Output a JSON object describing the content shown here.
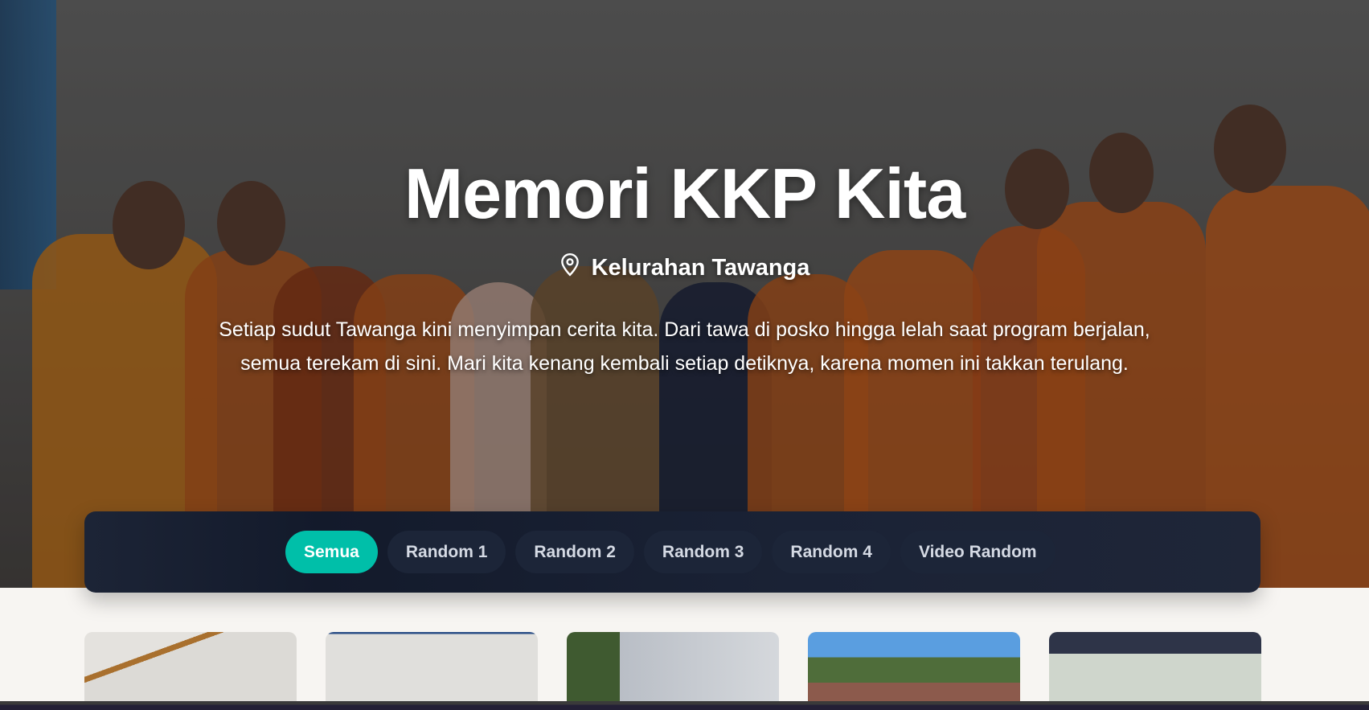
{
  "hero": {
    "title": "Memori KKP Kita",
    "location": "Kelurahan Tawanga",
    "location_icon": "map-pin-icon",
    "description": "Setiap sudut Tawanga kini menyimpan cerita kita. Dari tawa di posko hingga lelah saat program berjalan, semua terekam di sini. Mari kita kenang kembali setiap detiknya, karena momen ini takkan terulang."
  },
  "filters": [
    {
      "label": "Semua",
      "active": true
    },
    {
      "label": "Random 1"
    },
    {
      "label": "Random 2"
    },
    {
      "label": "Random 3"
    },
    {
      "label": "Random 4"
    },
    {
      "label": "Video Random"
    }
  ],
  "colors": {
    "accent": "#00bfa9",
    "filter_bar": "#161d2e",
    "page_bg": "#f7f5f2"
  }
}
